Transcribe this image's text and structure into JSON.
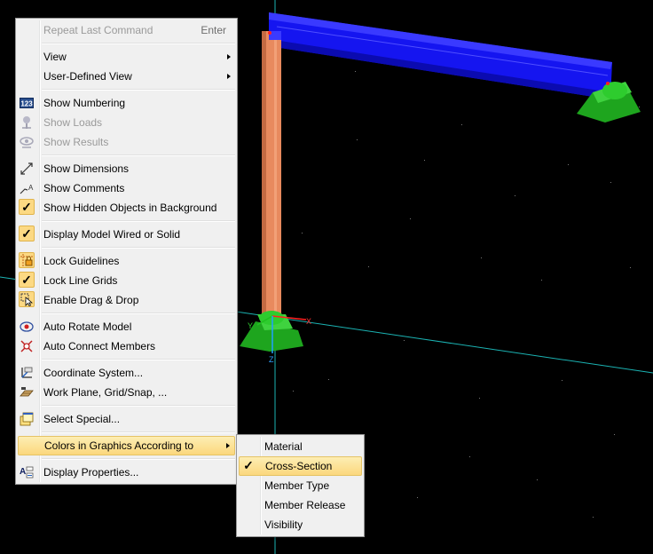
{
  "viewport": {
    "background": "#000000",
    "axis_labels": {
      "x": "X",
      "y": "Y",
      "z": "Z"
    }
  },
  "context_menu": {
    "items": [
      {
        "label": "Repeat Last Command",
        "shortcut": "Enter",
        "enabled": false
      },
      {
        "label": "View",
        "submenu": true
      },
      {
        "label": "User-Defined View",
        "submenu": true
      },
      {
        "label": "Show Numbering",
        "icon": "numbering-icon"
      },
      {
        "label": "Show Loads",
        "icon": "loads-icon",
        "enabled": false
      },
      {
        "label": "Show Results",
        "icon": "results-icon",
        "enabled": false
      },
      {
        "label": "Show Dimensions",
        "icon": "dimensions-icon"
      },
      {
        "label": "Show Comments",
        "icon": "comments-icon"
      },
      {
        "label": "Show Hidden Objects in Background",
        "checked": true
      },
      {
        "label": "Display Model Wired or Solid",
        "checked": true
      },
      {
        "label": "Lock Guidelines",
        "icon": "lock-guidelines-icon",
        "checked": true
      },
      {
        "label": "Lock Line Grids",
        "checked": true
      },
      {
        "label": "Enable Drag & Drop",
        "icon": "drag-drop-icon",
        "checked": true
      },
      {
        "label": "Auto Rotate Model",
        "icon": "auto-rotate-icon"
      },
      {
        "label": "Auto Connect Members",
        "icon": "auto-connect-icon"
      },
      {
        "label": "Coordinate System...",
        "icon": "coordinate-system-icon"
      },
      {
        "label": "Work Plane, Grid/Snap, ...",
        "icon": "work-plane-icon"
      },
      {
        "label": "Select Special...",
        "icon": "select-special-icon"
      },
      {
        "label": "Colors in Graphics According to",
        "submenu": true,
        "highlighted": true
      },
      {
        "label": "Display Properties...",
        "icon": "display-properties-icon"
      }
    ]
  },
  "submenu": {
    "items": [
      {
        "label": "Material"
      },
      {
        "label": "Cross-Section",
        "checked": true,
        "highlighted": true
      },
      {
        "label": "Member Type"
      },
      {
        "label": "Member Release"
      },
      {
        "label": "Visibility"
      }
    ]
  },
  "colors": {
    "menu_bg": "#f0f0f0",
    "highlight": "#fbd77d",
    "beam": "#1a1aff",
    "column": "#e0845a",
    "support": "#22b822",
    "grid_line": "#1bb3b3"
  }
}
